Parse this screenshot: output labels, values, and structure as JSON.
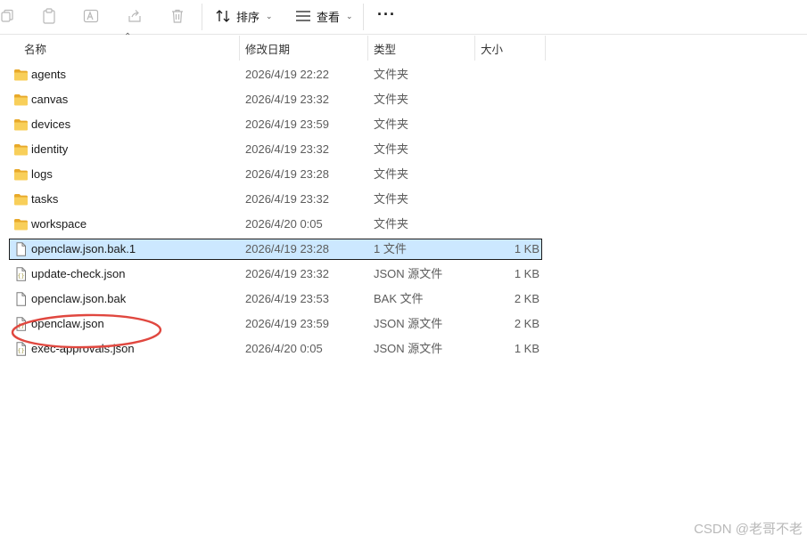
{
  "toolbar": {
    "sort_label": "排序",
    "view_label": "查看",
    "more_label": "···"
  },
  "columns": {
    "name": "名称",
    "date": "修改日期",
    "type": "类型",
    "size": "大小"
  },
  "files": [
    {
      "name": "agents",
      "date": "2026/4/19 22:22",
      "type": "文件夹",
      "size": "",
      "icon": "folder-icon"
    },
    {
      "name": "canvas",
      "date": "2026/4/19 23:32",
      "type": "文件夹",
      "size": "",
      "icon": "folder-icon"
    },
    {
      "name": "devices",
      "date": "2026/4/19 23:59",
      "type": "文件夹",
      "size": "",
      "icon": "folder-icon"
    },
    {
      "name": "identity",
      "date": "2026/4/19 23:32",
      "type": "文件夹",
      "size": "",
      "icon": "folder-icon"
    },
    {
      "name": "logs",
      "date": "2026/4/19 23:28",
      "type": "文件夹",
      "size": "",
      "icon": "folder-icon"
    },
    {
      "name": "tasks",
      "date": "2026/4/19 23:32",
      "type": "文件夹",
      "size": "",
      "icon": "folder-icon"
    },
    {
      "name": "workspace",
      "date": "2026/4/20 0:05",
      "type": "文件夹",
      "size": "",
      "icon": "folder-icon"
    },
    {
      "name": "openclaw.json.bak.1",
      "date": "2026/4/19 23:28",
      "type": "1 文件",
      "size": "1 KB",
      "icon": "file-icon",
      "selected": true
    },
    {
      "name": "update-check.json",
      "date": "2026/4/19 23:32",
      "type": "JSON 源文件",
      "size": "1 KB",
      "icon": "json-file-icon"
    },
    {
      "name": "openclaw.json.bak",
      "date": "2026/4/19 23:53",
      "type": "BAK 文件",
      "size": "2 KB",
      "icon": "file-icon"
    },
    {
      "name": "openclaw.json",
      "date": "2026/4/19 23:59",
      "type": "JSON 源文件",
      "size": "2 KB",
      "icon": "json-file-icon",
      "circled": true
    },
    {
      "name": "exec-approvals.json",
      "date": "2026/4/20 0:05",
      "type": "JSON 源文件",
      "size": "1 KB",
      "icon": "json-file-icon"
    }
  ],
  "colors": {
    "folder": "#f3c04c",
    "selection": "#cce8ff",
    "annotation": "#e0473f"
  },
  "watermark": "CSDN @老哥不老"
}
